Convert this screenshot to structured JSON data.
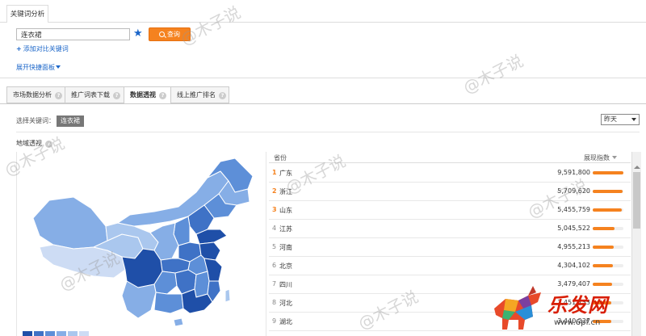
{
  "header": {
    "tab_label": "关键词分析"
  },
  "search": {
    "value": "连衣裙",
    "query_label": "查询",
    "add_compare": "添加对比关键词",
    "expand": "展开快捷面板"
  },
  "tabs": [
    {
      "label": "市场数据分析",
      "active": false
    },
    {
      "label": "推广词表下载",
      "active": false
    },
    {
      "label": "数据透视",
      "active": true
    },
    {
      "label": "线上推广排名",
      "active": false
    }
  ],
  "filter": {
    "label": "选择关键词：",
    "keyword": "连衣裙",
    "date": "昨天"
  },
  "section": {
    "title": "地域透视"
  },
  "table": {
    "col_province": "省份",
    "col_index": "展现指数",
    "rows": [
      {
        "rank": "1",
        "province": "广东",
        "value": "9,591,800",
        "level": 1.0
      },
      {
        "rank": "2",
        "province": "浙江",
        "value": "5,709,620",
        "level": 0.98
      },
      {
        "rank": "3",
        "province": "山东",
        "value": "5,455,759",
        "level": 0.95
      },
      {
        "rank": "4",
        "province": "江苏",
        "value": "5,045,522",
        "level": 0.7
      },
      {
        "rank": "5",
        "province": "河南",
        "value": "4,955,213",
        "level": 0.68
      },
      {
        "rank": "6",
        "province": "北京",
        "value": "4,304,102",
        "level": 0.66
      },
      {
        "rank": "7",
        "province": "四川",
        "value": "3,479,407",
        "level": 0.62
      },
      {
        "rank": "8",
        "province": "河北",
        "value": "3,451,133",
        "level": 0.6
      },
      {
        "rank": "9",
        "province": "湖北",
        "value": "3,440,227",
        "level": 0.6
      }
    ]
  },
  "legend_colors": [
    "#1f4fa8",
    "#3f72c6",
    "#5d8fd8",
    "#86aee6",
    "#aac7ee",
    "#cddcf4"
  ],
  "watermark": "@木子说",
  "logo": {
    "text": "乐发网",
    "url": "www.6pf.cn"
  }
}
